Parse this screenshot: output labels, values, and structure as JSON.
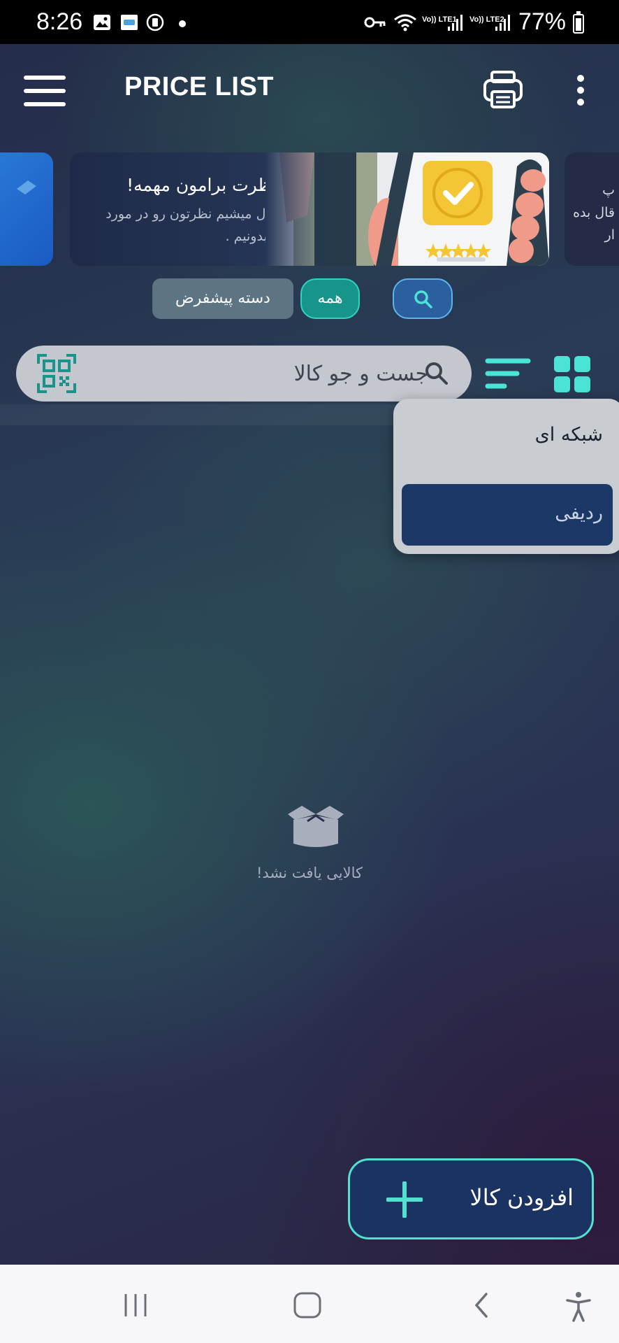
{
  "status_bar": {
    "time": "8:26",
    "battery_percent": "77%",
    "icons": [
      "gallery-icon",
      "app-notification-icon",
      "screen-record-icon",
      "key-icon",
      "wifi-icon",
      "signal-icon",
      "battery-icon"
    ],
    "sim1_label": "Vo)) LTE1",
    "sim2_label": "Vo)) LTE2"
  },
  "app_bar": {
    "title": "PRICE LIST",
    "icons": [
      "menu-icon",
      "print-icon",
      "more-vertical-icon"
    ]
  },
  "banners": {
    "main": {
      "title": "💬 نظرت برامون مهمه!",
      "subtitle": "خوشحال میشیم نظرتون رو در مورد برنامه بدونیم ."
    },
    "right_partial_text": "پ\nقال بده\nار"
  },
  "filters": {
    "default_category_label": "دسته پیشفرض",
    "all_label": "همه",
    "search_chip_icon": "search-icon"
  },
  "search": {
    "placeholder": "جست و جو کالا",
    "icons": [
      "search-icon",
      "qr-scan-icon",
      "sort-icon",
      "grid-view-icon"
    ]
  },
  "view_menu": {
    "grid_label": "شبکه ای",
    "row_label": "ردیفی",
    "selected": "ردیفی"
  },
  "empty_state": {
    "icon": "empty-box-icon",
    "message": "کالایی یافت نشد!"
  },
  "fab": {
    "label": "افزودن کالا",
    "icon": "plus-icon"
  },
  "nav_bar": {
    "buttons": [
      "recents-icon",
      "home-icon",
      "back-icon",
      "accessibility-icon"
    ]
  },
  "colors": {
    "accent_teal": "#54e0cf",
    "fab_bg": "#1b3362",
    "dropdown_selected": "#1b3866",
    "chip_all": "#17958a"
  }
}
